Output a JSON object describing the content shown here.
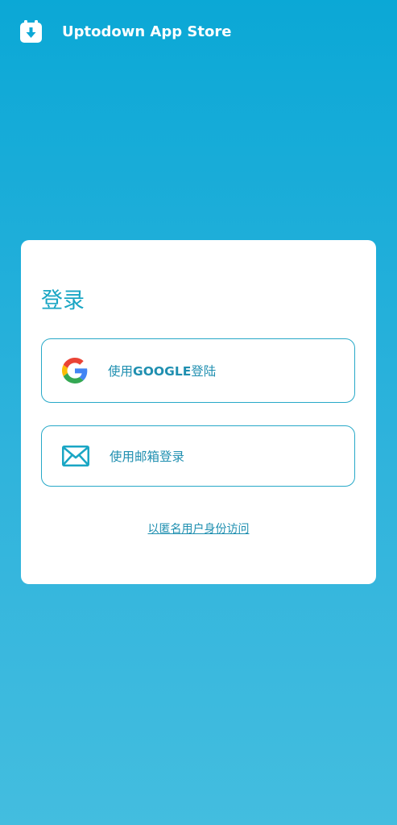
{
  "app": {
    "title": "Uptodown App Store",
    "logo_icon": "uptodown-logo-icon"
  },
  "login": {
    "title": "登录",
    "google_button": {
      "prefix": "使用",
      "brand": "GOOGLE",
      "suffix": "登陆",
      "icon": "google-icon"
    },
    "email_button": {
      "label": "使用邮箱登录",
      "icon": "mail-icon"
    },
    "anonymous_link": "以匿名用户身份访问"
  },
  "colors": {
    "background_top": "#0ba8d6",
    "background_bottom": "#43bddf",
    "accent": "#1aa6c4",
    "card": "#ffffff"
  }
}
